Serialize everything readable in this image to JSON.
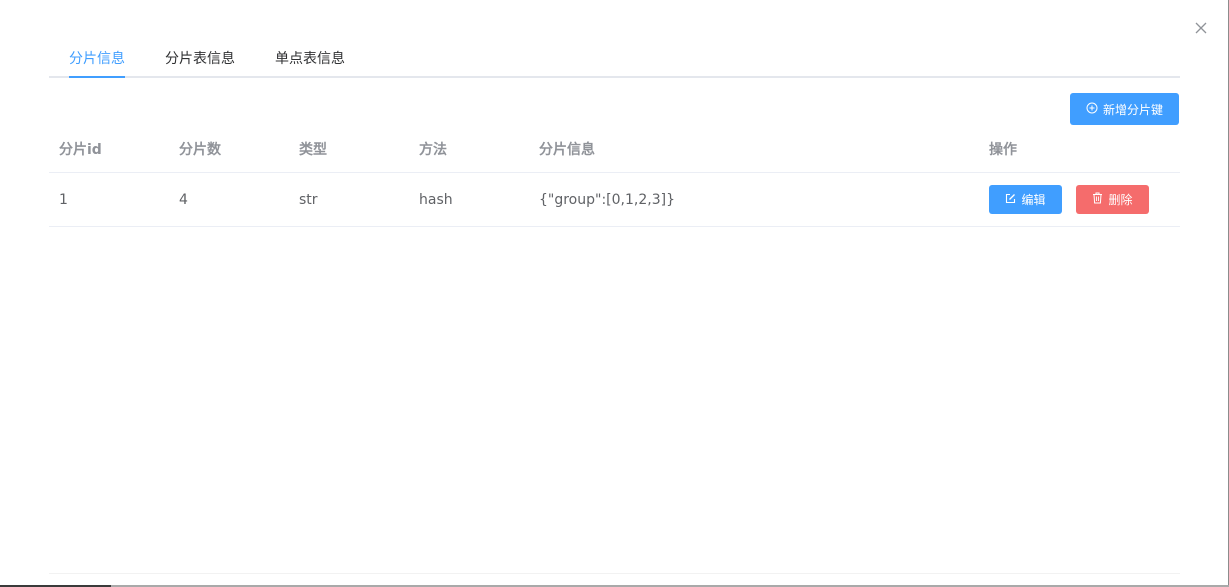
{
  "tabs": [
    {
      "label": "分片信息"
    },
    {
      "label": "分片表信息"
    },
    {
      "label": "单点表信息"
    }
  ],
  "active_tab_index": 0,
  "toolbar": {
    "add_label": "新增分片键",
    "add_icon": "circle-plus-icon"
  },
  "table": {
    "headers": [
      "分片id",
      "分片数",
      "类型",
      "方法",
      "分片信息",
      "操作"
    ],
    "rows": [
      {
        "id": "1",
        "count": "4",
        "type": "str",
        "method": "hash",
        "info": "{\"group\":[0,1,2,3]}",
        "edit_label": "编辑",
        "delete_label": "删除"
      }
    ]
  },
  "colors": {
    "primary": "#409eff",
    "danger": "#f56c6c",
    "header_text": "#909399",
    "body_text": "#606266"
  }
}
